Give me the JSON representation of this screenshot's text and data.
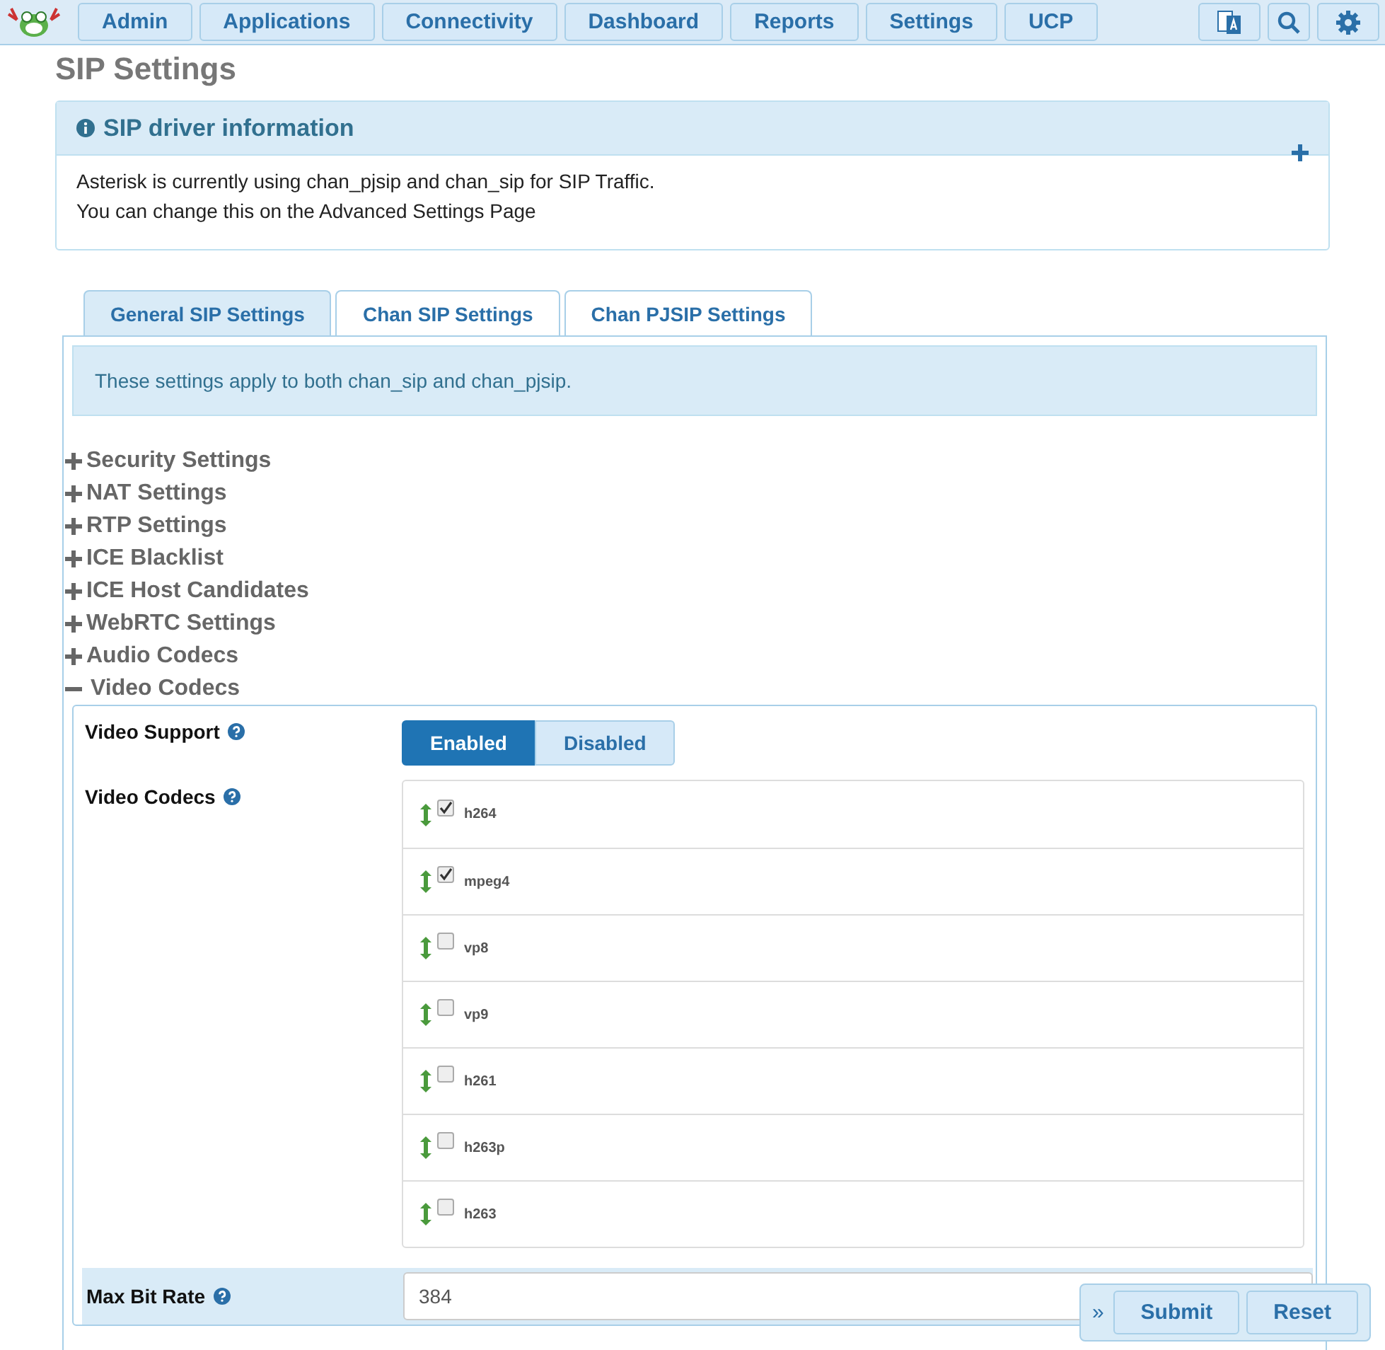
{
  "nav": {
    "items": [
      "Admin",
      "Applications",
      "Connectivity",
      "Dashboard",
      "Reports",
      "Settings",
      "UCP"
    ]
  },
  "page_title": "SIP Settings",
  "info_panel": {
    "title": "SIP driver information",
    "expanded": false,
    "lines": [
      "Asterisk is currently using chan_pjsip and chan_sip for SIP Traffic.",
      "You can change this on the Advanced Settings Page"
    ]
  },
  "tabs": [
    {
      "label": "General SIP Settings",
      "selected": true
    },
    {
      "label": "Chan SIP Settings",
      "selected": false
    },
    {
      "label": "Chan PJSIP Settings",
      "selected": false
    }
  ],
  "notice": "These settings apply to both chan_sip and chan_pjsip.",
  "sections": [
    {
      "label": "Security Settings",
      "expanded": false
    },
    {
      "label": "NAT Settings",
      "expanded": false
    },
    {
      "label": "RTP Settings",
      "expanded": false
    },
    {
      "label": "ICE Blacklist",
      "expanded": false
    },
    {
      "label": "ICE Host Candidates",
      "expanded": false
    },
    {
      "label": "WebRTC Settings",
      "expanded": false
    },
    {
      "label": "Audio Codecs",
      "expanded": false
    },
    {
      "label": "Video Codecs",
      "expanded": true
    }
  ],
  "video": {
    "support_label": "Video Support",
    "support_options": [
      {
        "label": "Enabled",
        "selected": true
      },
      {
        "label": "Disabled",
        "selected": false
      }
    ],
    "codecs_label": "Video Codecs",
    "codecs": [
      {
        "name": "h264",
        "checked": true
      },
      {
        "name": "mpeg4",
        "checked": true
      },
      {
        "name": "vp8",
        "checked": false
      },
      {
        "name": "vp9",
        "checked": false
      },
      {
        "name": "h261",
        "checked": false
      },
      {
        "name": "h263p",
        "checked": false
      },
      {
        "name": "h263",
        "checked": false
      }
    ],
    "max_bit_rate_label": "Max Bit Rate",
    "max_bit_rate": "384"
  },
  "actions": {
    "toggle": "»",
    "buttons": [
      "Submit",
      "Reset"
    ]
  }
}
